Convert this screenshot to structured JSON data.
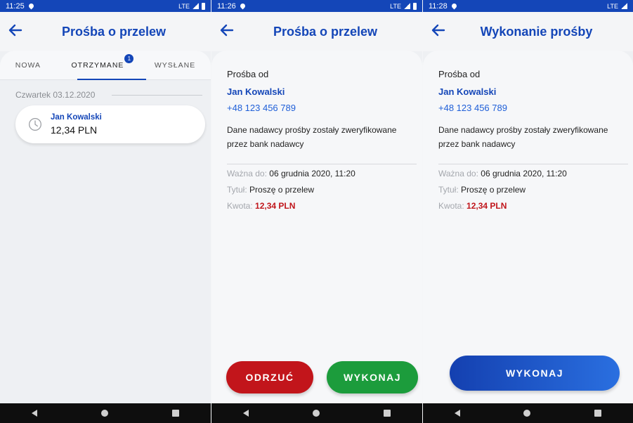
{
  "screens": [
    {
      "time": "11:25",
      "network": "LTE",
      "title": "Prośba o przelew",
      "tabs": [
        {
          "label": "NOWA"
        },
        {
          "label": "OTRZYMANE",
          "badge": "1"
        },
        {
          "label": "WYSŁANE"
        }
      ],
      "date": "Czwartek 03.12.2020",
      "request": {
        "name": "Jan Kowalski",
        "amount": "12,34 PLN"
      }
    },
    {
      "time": "11:26",
      "network": "LTE",
      "title": "Prośba o przelew",
      "from_label": "Prośba od",
      "from_name": "Jan Kowalski",
      "phone": "+48 123 456 789",
      "verification": "Dane nadawcy prośby zostały zweryfikowane przez bank nadawcy",
      "valid_label": "Ważna do:",
      "valid_value": "06 grudnia 2020, 11:20",
      "title_label": "Tytuł:",
      "title_value": "Proszę o przelew",
      "amount_label": "Kwota:",
      "amount_value": "12,34 PLN",
      "reject_label": "ODRZUĆ",
      "execute_label": "WYKONAJ"
    },
    {
      "time": "11:28",
      "network": "LTE",
      "title": "Wykonanie prośby",
      "from_label": "Prośba od",
      "from_name": "Jan Kowalski",
      "phone": "+48 123 456 789",
      "verification": "Dane nadawcy prośby zostały zweryfikowane przez bank nadawcy",
      "valid_label": "Ważna do:",
      "valid_value": "06 grudnia 2020, 11:20",
      "title_label": "Tytuł:",
      "title_value": "Proszę o przelew",
      "amount_label": "Kwota:",
      "amount_value": "12,34 PLN",
      "execute_label": "WYKONAJ"
    }
  ],
  "colors": {
    "brand": "#1446b8",
    "reject": "#c2151b",
    "accept": "#1c9c3c",
    "amount": "#c0151b"
  }
}
